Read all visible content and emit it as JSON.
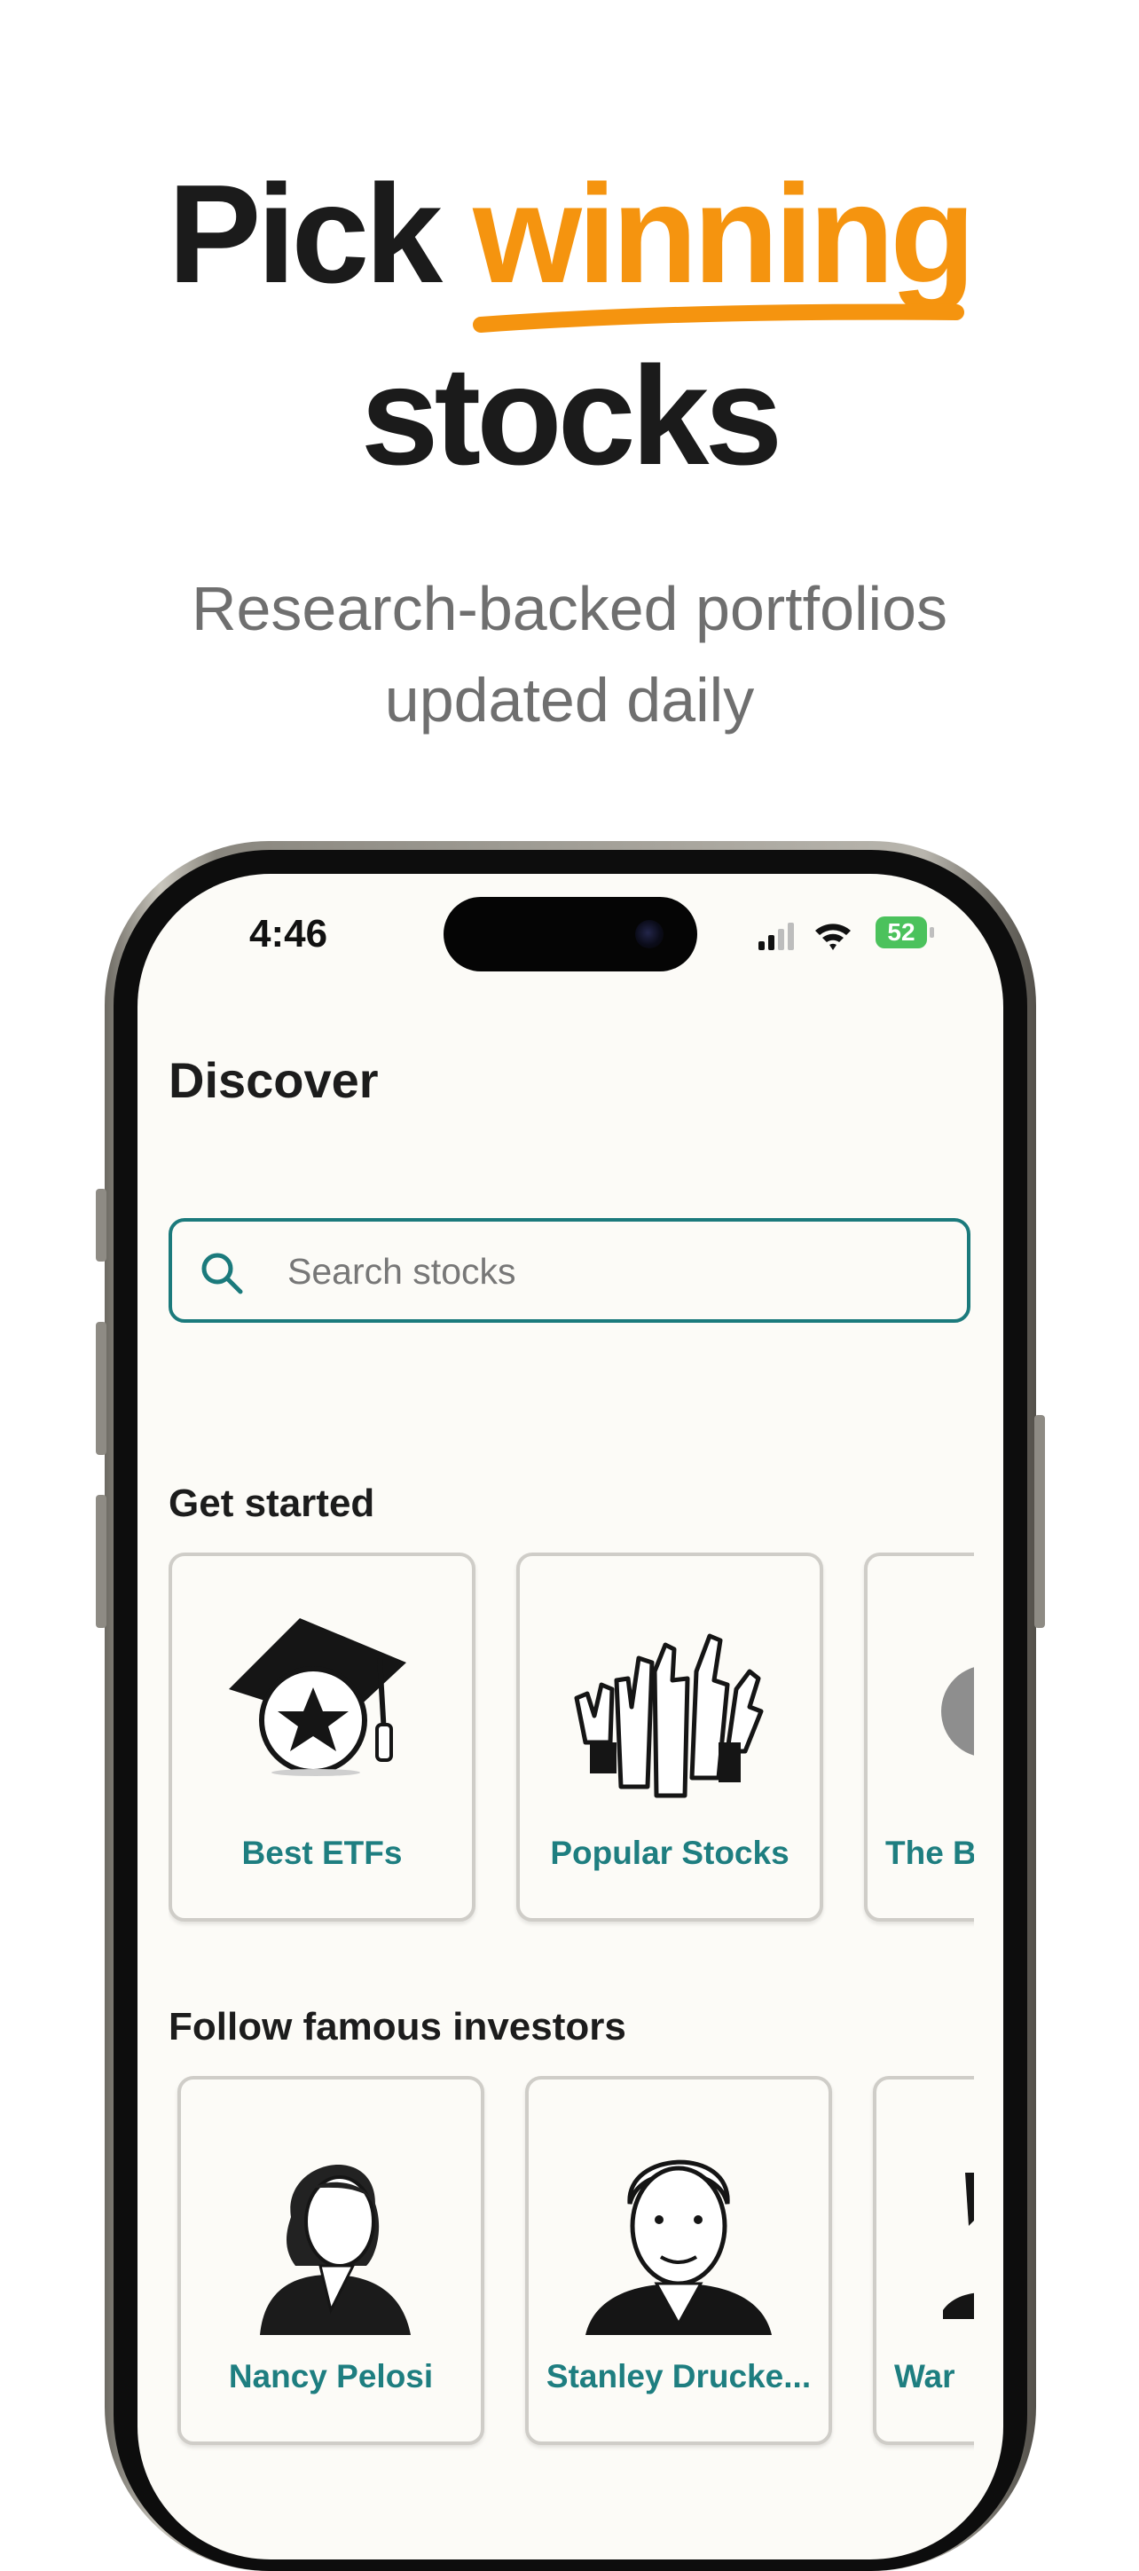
{
  "hero": {
    "headline_part1": "Pick",
    "headline_accent": "winning",
    "headline_part2": "stocks",
    "subtitle_line1": "Research-backed portfolios",
    "subtitle_line2": "updated daily",
    "accent_color": "#f5940f"
  },
  "status_bar": {
    "time": "4:46",
    "battery": "52",
    "icons": [
      "signal-icon",
      "wifi-icon",
      "battery-charging-icon"
    ]
  },
  "discover": {
    "title": "Discover",
    "search_placeholder": "Search stocks",
    "brand_color": "#1b7a7c"
  },
  "get_started": {
    "title": "Get started",
    "cards": [
      {
        "label": "Best ETFs",
        "icon": "graduation-cap-icon"
      },
      {
        "label": "Popular Stocks",
        "icon": "thumbs-up-hands-icon"
      },
      {
        "label": "The B",
        "icon": "circle-icon"
      }
    ]
  },
  "investors": {
    "title": "Follow famous investors",
    "cards": [
      {
        "label": "Nancy Pelosi",
        "icon": "portrait-icon"
      },
      {
        "label": "Stanley Drucke...",
        "icon": "portrait-icon"
      },
      {
        "label": "War",
        "icon": "portrait-icon"
      }
    ]
  }
}
